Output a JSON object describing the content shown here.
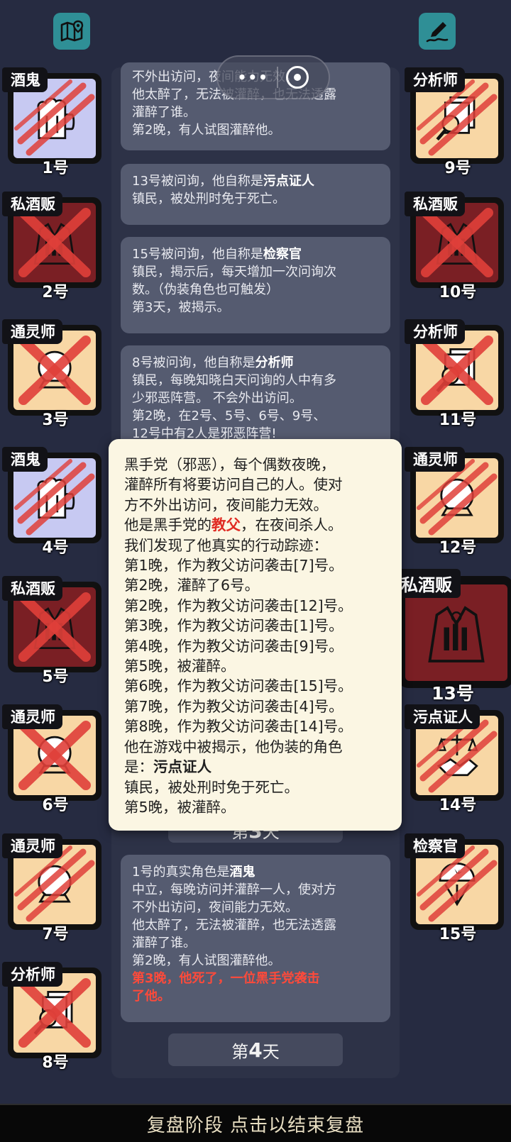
{
  "header": {
    "map_icon": "map-pin-icon",
    "notes_icon": "notes-pen-icon",
    "capsule_menu": "•••"
  },
  "log": {
    "messages": [
      {
        "lines": [
          "不外出访问，夜间能力无效。",
          "他太醉了，无法被灌醉，也无法透露",
          "灌醉了谁。",
          "第2晚，有人试图灌醉他。"
        ]
      },
      {
        "prefix": "13号被问询，他自称是",
        "role": "污点证人",
        "lines": [
          "镇民，被处刑时免于死亡。"
        ]
      },
      {
        "prefix": "15号被问询，他自称是",
        "role": "检察官",
        "lines": [
          "镇民，揭示后，每天增加一次问询次",
          "数。（伪装角色也可触发）",
          "第3天，被揭示。"
        ]
      },
      {
        "prefix": "8号被问询，他自称是",
        "role": "分析师",
        "lines": [
          "镇民，每晚知晓白天问询的人中有多",
          "少邪恶阵营。 不会外出访问。",
          "第2晚，在2号、5号、6号、9号、",
          "12号中有2人是邪恶阵营!"
        ]
      },
      {
        "prefix": "1号的真实角色是",
        "role": "酒鬼",
        "lines": [
          "中立，每晚访问并灌醉一人，使对方",
          "不外出访问，夜间能力无效。",
          "他太醉了，无法被灌醉，也无法透露",
          "灌醉了谁。",
          "第2晚，有人试图灌醉他。"
        ],
        "red_lines": [
          "第3晚，他死了，一位黑手党袭击",
          "了他。"
        ]
      }
    ],
    "day_bar_hidden": {
      "pre": "第",
      "num": "3",
      "post": "天"
    },
    "day_bar": {
      "pre": "第",
      "num": "4",
      "post": "天"
    }
  },
  "players_left": [
    {
      "role": "酒鬼",
      "num": "1号",
      "color": "purple",
      "icon": "beer-mug-icon",
      "dead": "slash"
    },
    {
      "role": "私酒贩",
      "num": "2号",
      "color": "maroon",
      "icon": "bootlegger-coat-icon",
      "dead": "cross"
    },
    {
      "role": "通灵师",
      "num": "3号",
      "color": "tan",
      "icon": "crystal-ball-icon",
      "dead": "cross"
    },
    {
      "role": "酒鬼",
      "num": "4号",
      "color": "purple",
      "icon": "beer-mug-icon",
      "dead": "slash"
    },
    {
      "role": "私酒贩",
      "num": "5号",
      "color": "maroon",
      "icon": "bootlegger-coat-icon",
      "dead": "cross"
    },
    {
      "role": "通灵师",
      "num": "6号",
      "color": "tan",
      "icon": "crystal-ball-icon",
      "dead": "cross"
    },
    {
      "role": "通灵师",
      "num": "7号",
      "color": "tan",
      "icon": "crystal-ball-icon",
      "dead": "slash"
    },
    {
      "role": "分析师",
      "num": "8号",
      "color": "tan",
      "icon": "magnifier-documents-icon",
      "dead": "cross"
    }
  ],
  "players_right": [
    {
      "role": "分析师",
      "num": "9号",
      "color": "tan",
      "icon": "magnifier-documents-icon",
      "dead": "slash"
    },
    {
      "role": "私酒贩",
      "num": "10号",
      "color": "maroon",
      "icon": "bootlegger-coat-icon",
      "dead": "cross"
    },
    {
      "role": "分析师",
      "num": "11号",
      "color": "tan",
      "icon": "magnifier-documents-icon",
      "dead": "cross"
    },
    {
      "role": "通灵师",
      "num": "12号",
      "color": "tan",
      "icon": "crystal-ball-icon",
      "dead": "slash"
    },
    {
      "role": "私酒贩",
      "num": "13号",
      "color": "maroon",
      "icon": "bootlegger-coat-icon",
      "dead": "none",
      "highlighted": true
    },
    {
      "role": "污点证人",
      "num": "14号",
      "color": "tan",
      "icon": "handshake-scales-icon",
      "dead": "slash"
    },
    {
      "role": "检察官",
      "num": "15号",
      "color": "tan",
      "icon": "prosecutor-badge-icon",
      "dead": "slash"
    }
  ],
  "popup": {
    "line1": "黑手党（邪恶），每个偶数夜晚，",
    "line2": "灌醉所有将要访问自己的人。使对",
    "line3": "方不外出访问，夜间能力无效。",
    "line4_pre": "他是黑手党的",
    "line4_red": "教父",
    "line4_post": "，在夜间杀人。",
    "line5": "我们发现了他真实的行动踪迹：",
    "actions": [
      "第1晚，作为教父访问袭击[7]号。",
      "第2晚，灌醉了6号。",
      "第2晚，作为教父访问袭击[12]号。",
      "第3晚，作为教父访问袭击[1]号。",
      "第4晚，作为教父访问袭击[9]号。",
      "第5晚，被灌醉。",
      "第6晚，作为教父访问袭击[15]号。",
      "第7晚，作为教父访问袭击[4]号。",
      "第8晚，作为教父访问袭击[14]号。"
    ],
    "reveal_line": "他在游戏中被揭示，他伪装的角色",
    "disguise_pre": "是：",
    "disguise_role": "污点证人",
    "disguise_desc": "镇民，被处刑时免于死亡。",
    "last_line": "第5晚，被灌醉。"
  },
  "bottom_bar": {
    "label": "复盘阶段 点击以结束复盘"
  },
  "colors": {
    "background": "#262b41",
    "message_bg": "#555b70",
    "popup_bg": "#fbf6e3",
    "evil_red": "#e02a22",
    "card_tan": "#f8d7a5",
    "card_purple": "#c7c9f2",
    "card_maroon": "#7a1f24"
  }
}
